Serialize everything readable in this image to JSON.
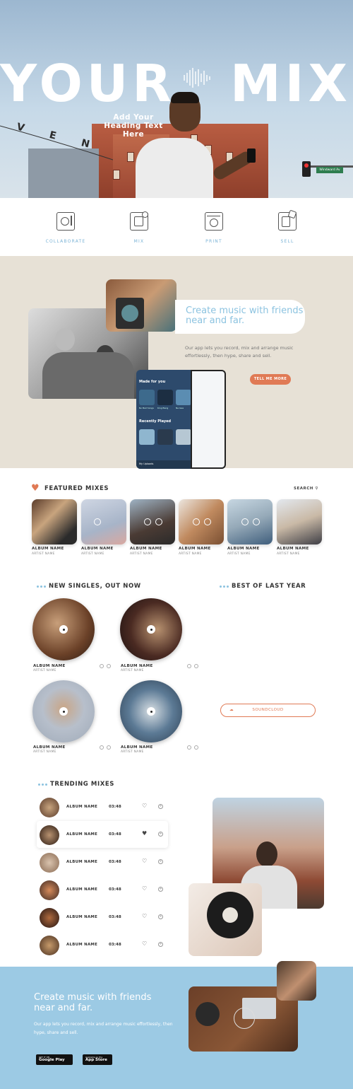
{
  "hero": {
    "word_left": "YOUR",
    "word_right": "MIX",
    "sign_text": "V E N",
    "street_sign": "Windward Av",
    "subheading_lines": [
      "Add Your",
      "Heading Text",
      "Here"
    ]
  },
  "features": [
    {
      "label": "COLLABORATE",
      "icon": "turntable-icon"
    },
    {
      "label": "MIX",
      "icon": "mixer-device-icon"
    },
    {
      "label": "PRINT",
      "icon": "vinyl-player-icon"
    },
    {
      "label": "SELL",
      "icon": "sell-device-icon"
    }
  ],
  "collab": {
    "title": "Create music with friends near and far.",
    "body": "Our app lets you record, mix and arrange music effortlessly, then hype, share and sell.",
    "button": "TELL ME MORE",
    "phone": {
      "made_for_you": "Made for you",
      "recently_played": "Recently Played",
      "item_labels": [
        "No Bad Songs",
        "King Bang",
        "Ne Gae"
      ],
      "footer_label": "My Uploads"
    }
  },
  "featured": {
    "title": "FEATURED MIXES",
    "search": "SEARCH",
    "items": [
      {
        "name": "ALBUM NAME",
        "artist": "ARTIST NAME"
      },
      {
        "name": "ALBUM NAME",
        "artist": "ARTIST NAME"
      },
      {
        "name": "ALBUM NAME",
        "artist": "ARTIST NAME"
      },
      {
        "name": "ALBUM NAME",
        "artist": "ARTIST NAME"
      },
      {
        "name": "ALBUM NAME",
        "artist": "ARTIST NAME"
      },
      {
        "name": "ALBUM NAME",
        "artist": "ARTIST NAME"
      }
    ]
  },
  "singles": {
    "title": "NEW SINGLES, OUT NOW",
    "items": [
      {
        "name": "ALBUM NAME",
        "artist": "ARTIST NAME"
      },
      {
        "name": "ALBUM NAME",
        "artist": "ARTIST NAME"
      },
      {
        "name": "ALBUM NAME",
        "artist": "ARTIST NAME"
      },
      {
        "name": "ALBUM NAME",
        "artist": "ARTIST NAME"
      }
    ]
  },
  "best": {
    "title": "BEST OF LAST YEAR",
    "soundcloud": "SOUNDCLOUD"
  },
  "trending": {
    "title": "TRENDING MIXES",
    "rows": [
      {
        "name": "ALBUM NAME",
        "time": "03:48",
        "liked": false
      },
      {
        "name": "ALBUM NAME",
        "time": "03:48",
        "liked": true
      },
      {
        "name": "ALBUM NAME",
        "time": "03:48",
        "liked": false
      },
      {
        "name": "ALBUM NAME",
        "time": "03:48",
        "liked": false
      },
      {
        "name": "ALBUM NAME",
        "time": "03:48",
        "liked": false
      },
      {
        "name": "ALBUM NAME",
        "time": "03:48",
        "liked": false
      }
    ]
  },
  "footer": {
    "title": "Create music with friends near and far.",
    "body": "Our app lets you record, mix and arrange music effortlessly, then hype, share and sell.",
    "google_small": "GET IT ON",
    "google": "Google Play",
    "apple_small": "Available on the",
    "apple": "App Store"
  },
  "colors": {
    "accent_blue": "#8cc3e0",
    "accent_orange": "#e07a55",
    "collab_bg": "#e7e1d6",
    "footer_bg": "#9ccae4"
  }
}
